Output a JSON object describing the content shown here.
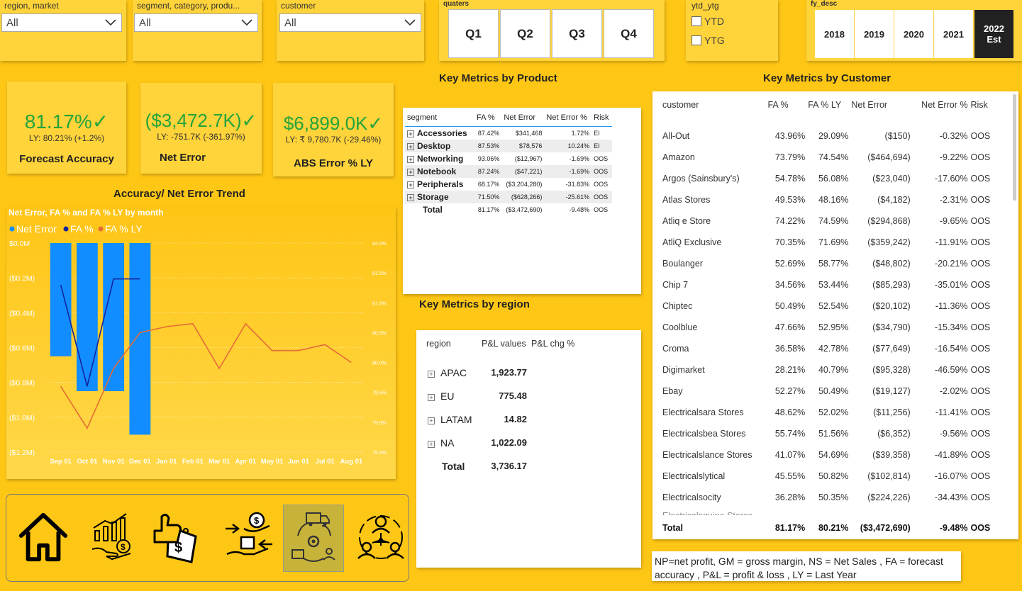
{
  "slicers": {
    "region": {
      "title": "region, market",
      "value": "All"
    },
    "segment": {
      "title": "segment, category, produ...",
      "value": "All"
    },
    "customer": {
      "title": "customer",
      "value": "All"
    },
    "quarters": {
      "title": "quaters",
      "items": [
        "Q1",
        "Q2",
        "Q3",
        "Q4"
      ]
    },
    "ytd": {
      "title": "ytd_ytg",
      "items": [
        "YTD",
        "YTG"
      ]
    },
    "fy": {
      "title": "fy_desc",
      "items": [
        "2018",
        "2019",
        "2020",
        "2021",
        "2022 Est"
      ],
      "active": "2022 Est"
    }
  },
  "kpis": [
    {
      "value": "81.17%✓",
      "ly": "LY: 80.21% (+1.2%)",
      "label": "Forecast Accuracy"
    },
    {
      "value": "($3,472.7K)✓",
      "ly": "LY: -751.7K (-361.97%)",
      "label": "Net Error"
    },
    {
      "value": "$6,899.0K✓",
      "ly": "LY: ₹ 9,780.7K (-29.46%)",
      "label": "ABS Error % LY"
    }
  ],
  "titles": {
    "product": "Key Metrics by  Product",
    "customer": "Key Metrics by  Customer",
    "region": "Key Metrics by  region",
    "trend": "Accuracy/ Net Error Trend"
  },
  "product_table": {
    "headers": [
      "segment",
      "FA %",
      "Net Error",
      "Net Error %",
      "Risk"
    ],
    "rows": [
      [
        "Accessories",
        "87.42%",
        "$341,468",
        "1.72%",
        "EI"
      ],
      [
        "Desktop",
        "87.53%",
        "$78,576",
        "10.24%",
        "EI"
      ],
      [
        "Networking",
        "93.06%",
        "($12,967)",
        "-1.69%",
        "OOS"
      ],
      [
        "Notebook",
        "87.24%",
        "($47,221)",
        "-1.69%",
        "OOS"
      ],
      [
        "Peripherals",
        "68.17%",
        "($3,204,280)",
        "-31.83%",
        "OOS"
      ],
      [
        "Storage",
        "71.50%",
        "($628,266)",
        "-25.61%",
        "OOS"
      ]
    ],
    "total": [
      "Total",
      "81.17%",
      "($3,472,690)",
      "-9.48%",
      "OOS"
    ]
  },
  "region_table": {
    "headers": [
      "region",
      "P&L values",
      "P&L chg %"
    ],
    "rows": [
      [
        "APAC",
        "1,923.77"
      ],
      [
        "EU",
        "775.48"
      ],
      [
        "LATAM",
        "14.82"
      ],
      [
        "NA",
        "1,022.09"
      ]
    ],
    "total": [
      "Total",
      "3,736.17"
    ]
  },
  "customer_table": {
    "headers": [
      "customer",
      "FA %",
      "FA % LY",
      "Net Error",
      "Net Error %",
      "Risk"
    ],
    "rows": [
      [
        "All-Out",
        "43.96%",
        "29.09%",
        "($150)",
        "-0.32%",
        "OOS"
      ],
      [
        "Amazon",
        "73.79%",
        "74.54%",
        "($464,694)",
        "-9.22%",
        "OOS"
      ],
      [
        "Argos (Sainsbury's)",
        "54.78%",
        "56.08%",
        "($23,040)",
        "-17.60%",
        "OOS"
      ],
      [
        "Atlas Stores",
        "49.53%",
        "48.16%",
        "($4,182)",
        "-2.31%",
        "OOS"
      ],
      [
        "Atliq e Store",
        "74.22%",
        "74.59%",
        "($294,868)",
        "-9.65%",
        "OOS"
      ],
      [
        "AtliQ Exclusive",
        "70.35%",
        "71.69%",
        "($359,242)",
        "-11.91%",
        "OOS"
      ],
      [
        "Boulanger",
        "52.69%",
        "58.77%",
        "($48,802)",
        "-20.21%",
        "OOS"
      ],
      [
        "Chip 7",
        "34.56%",
        "53.44%",
        "($85,293)",
        "-35.01%",
        "OOS"
      ],
      [
        "Chiptec",
        "50.49%",
        "52.54%",
        "($20,102)",
        "-11.36%",
        "OOS"
      ],
      [
        "Coolblue",
        "47.66%",
        "52.95%",
        "($34,790)",
        "-15.34%",
        "OOS"
      ],
      [
        "Croma",
        "36.58%",
        "42.78%",
        "($77,649)",
        "-16.54%",
        "OOS"
      ],
      [
        "Digimarket",
        "28.21%",
        "40.79%",
        "($95,328)",
        "-46.59%",
        "OOS"
      ],
      [
        "Ebay",
        "52.27%",
        "50.49%",
        "($19,127)",
        "-2.02%",
        "OOS"
      ],
      [
        "Electricalsara Stores",
        "48.62%",
        "52.02%",
        "($11,256)",
        "-11.41%",
        "OOS"
      ],
      [
        "Electricalsbea Stores",
        "55.74%",
        "51.56%",
        "($6,352)",
        "-9.56%",
        "OOS"
      ],
      [
        "Electricalslance Stores",
        "41.07%",
        "54.69%",
        "($39,358)",
        "-41.89%",
        "OOS"
      ],
      [
        "Electricalslytical",
        "45.55%",
        "50.82%",
        "($102,814)",
        "-16.07%",
        "OOS"
      ],
      [
        "Electricalsocity",
        "36.28%",
        "50.35%",
        "($224,226)",
        "-34.43%",
        "OOS"
      ]
    ],
    "total": [
      "Total",
      "81.17%",
      "80.21%",
      "($3,472,690)",
      "-9.48%",
      "OOS"
    ]
  },
  "note": "NP=net profit, GM = gross margin, NS = Net Sales , FA = forecast accuracy ,  P&L = profit & loss , LY = Last Year",
  "nav_icons": [
    "home-icon",
    "sales-growth-icon",
    "price-tag-icon",
    "finance-exchange-icon",
    "supply-chain-icon",
    "team-icon"
  ],
  "colors": {
    "background": "#FFC715",
    "kpi_green": "#23A43B",
    "bar_blue": "#118DFF",
    "fa_line": "#12239E",
    "fa_ly_line": "#E66C37"
  },
  "chart_data": {
    "type": "bar",
    "title": "Net Error, FA % and FA % LY by month",
    "legend": [
      "Net Error",
      "FA %",
      "FA  % LY"
    ],
    "legend_position": "top-left",
    "categories": [
      "Sep 01",
      "Oct 01",
      "Nov 01",
      "Dec 01",
      "Jan 01",
      "Feb 01",
      "Mar 01",
      "Apr 01",
      "May 01",
      "Jun 01",
      "Jul 01",
      "Aug 01"
    ],
    "y_left_ticks": [
      "$0.0M",
      "($0.2M)",
      "($0.4M)",
      "($0.6M)",
      "($0.8M)",
      "($1.0M)",
      "($1.2M)"
    ],
    "y_left_range": [
      -1.2,
      0
    ],
    "y_right_ticks": [
      "82.0%",
      "81.5%",
      "81.0%",
      "80.5%",
      "80.0%",
      "79.5%",
      "79.0%",
      "78.5%"
    ],
    "y_right_range": [
      78.5,
      82.0
    ],
    "series": [
      {
        "name": "Net Error",
        "type": "bar",
        "values": [
          -0.65,
          -0.85,
          -0.85,
          -1.1,
          null,
          null,
          null,
          null,
          null,
          null,
          null,
          null
        ]
      },
      {
        "name": "FA %",
        "type": "line",
        "values": [
          81.3,
          79.6,
          81.4,
          81.4,
          null,
          null,
          null,
          null,
          null,
          null,
          null,
          null
        ]
      },
      {
        "name": "FA  % LY",
        "type": "line",
        "values": [
          79.6,
          78.9,
          79.9,
          80.5,
          80.6,
          80.65,
          79.9,
          80.65,
          80.2,
          80.2,
          80.3,
          80.0
        ]
      }
    ]
  }
}
